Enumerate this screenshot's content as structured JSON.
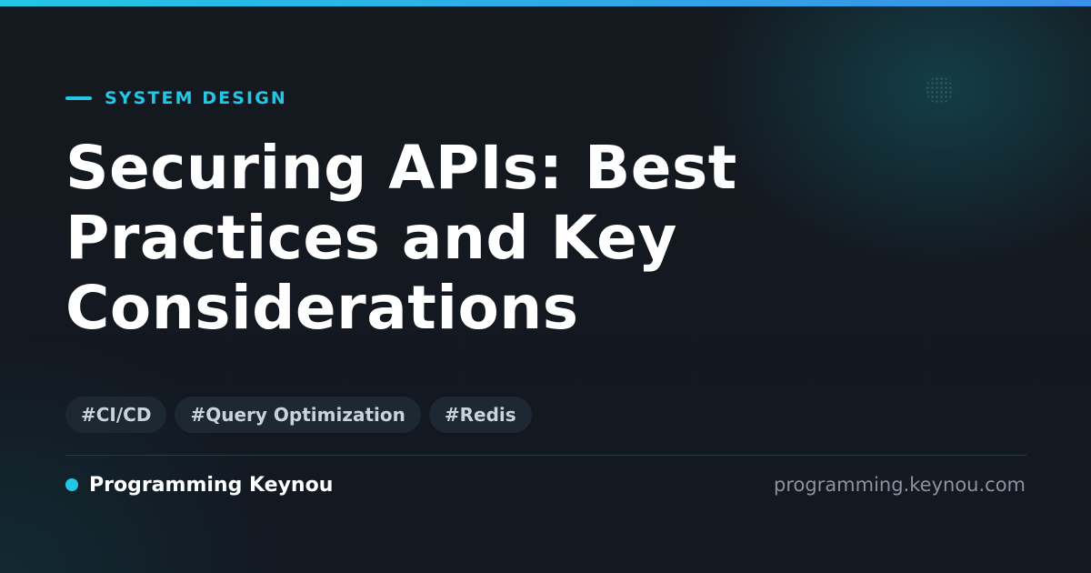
{
  "category": "SYSTEM DESIGN",
  "title": "Securing APIs: Best Practices and Key Considerations",
  "tags": [
    "#CI/CD",
    "#Query Optimization",
    "#Redis"
  ],
  "brand": {
    "name": "Programming Keynou",
    "url": "programming.keynou.com"
  },
  "colors": {
    "accent": "#22c7e6",
    "accent_end": "#3a8fe8",
    "background": "#131821",
    "tag_background": "#1d2832",
    "tag_text": "#c9d3dd",
    "muted_text": "#8a939e"
  }
}
